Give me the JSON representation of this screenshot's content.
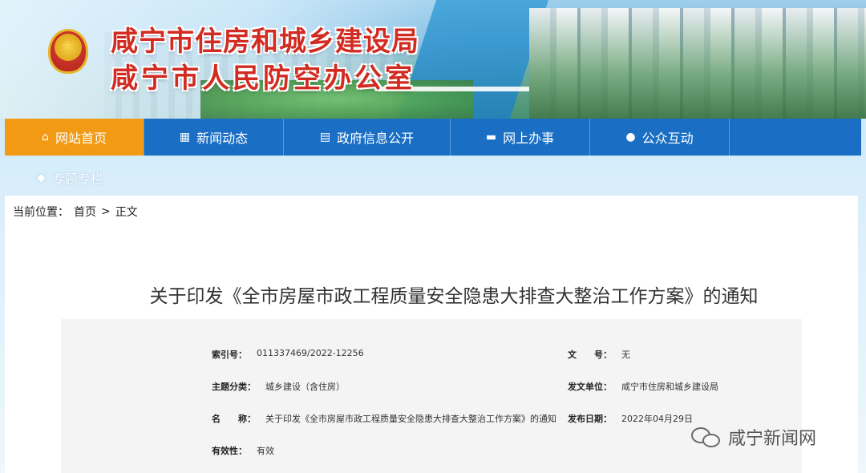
{
  "header": {
    "title_line1": "咸宁市住房和城乡建设局",
    "title_line2": "咸宁市人民防空办公室"
  },
  "nav": {
    "items": [
      {
        "label": "网站首页",
        "icon": "home-icon",
        "active": true
      },
      {
        "label": "新闻动态",
        "icon": "grid-icon",
        "active": false
      },
      {
        "label": "政府信息公开",
        "icon": "document-icon",
        "active": false
      },
      {
        "label": "网上办事",
        "icon": "folder-icon",
        "active": false
      },
      {
        "label": "公众互动",
        "icon": "chat-icon",
        "active": false
      }
    ],
    "special_label": "专题专栏",
    "active_color": "#f29a13",
    "base_color": "#1a6fc4"
  },
  "breadcrumb": {
    "prefix": "当前位置：",
    "home": "首页",
    "separator": ">",
    "current": "正文"
  },
  "article": {
    "title": "关于印发《全市房屋市政工程质量安全隐患大排查大整治工作方案》的通知"
  },
  "info": {
    "index_label": "索引号：",
    "index_value": "011337469/2022-12256",
    "doc_no_label": "文　　号：",
    "doc_no_value": "无",
    "category_label": "主题分类：",
    "category_value": "城乡建设（含住房）",
    "issuer_label": "发文单位：",
    "issuer_value": "咸宁市住房和城乡建设局",
    "name_label": "名　　称：",
    "name_value": "关于印发《全市房屋市政工程质量安全隐患大排查大整治工作方案》的通知",
    "date_label": "发布日期：",
    "date_value": "2022年04月29日",
    "validity_label": "有效性：",
    "validity_value": "有效"
  },
  "watermark": {
    "text": "咸宁新闻网"
  }
}
